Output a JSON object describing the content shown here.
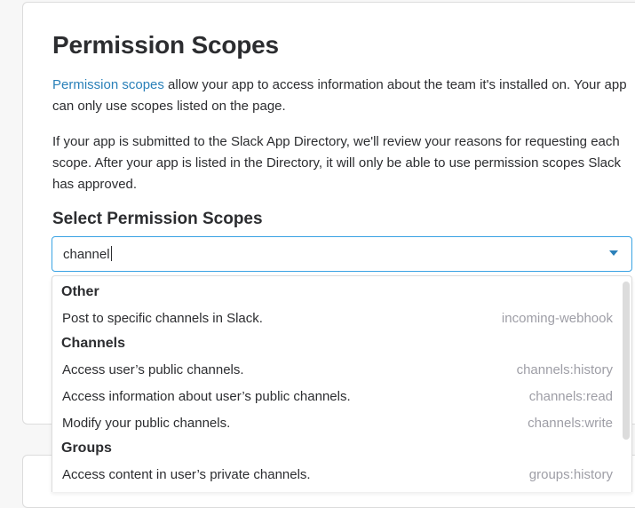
{
  "page": {
    "title": "Permission Scopes",
    "intro_link": "Permission scopes",
    "intro_text": " allow your app to access information about the team it's installed on. Your app can only use scopes listed on the page.",
    "directory_text": "If your app is submitted to the Slack App Directory, we'll review your reasons for requesting each scope. After your app is listed in the Directory, it will only be able to use permission scopes Slack has approved."
  },
  "select": {
    "heading": "Select Permission Scopes",
    "value": "channel"
  },
  "dropdown": {
    "groups": [
      {
        "label": "Other",
        "options": [
          {
            "description": "Post to specific channels in Slack.",
            "scope": "incoming-webhook"
          }
        ]
      },
      {
        "label": "Channels",
        "options": [
          {
            "description": "Access user’s public channels.",
            "scope": "channels:history"
          },
          {
            "description": "Access information about user’s public channels.",
            "scope": "channels:read"
          },
          {
            "description": "Modify your public channels.",
            "scope": "channels:write"
          }
        ]
      },
      {
        "label": "Groups",
        "options": [
          {
            "description": "Access content in user’s private channels.",
            "scope": "groups:history"
          }
        ]
      }
    ]
  },
  "colors": {
    "link": "#2a80b9",
    "focus_border": "#3aa3e3",
    "scope_text": "#9e9ea6"
  }
}
